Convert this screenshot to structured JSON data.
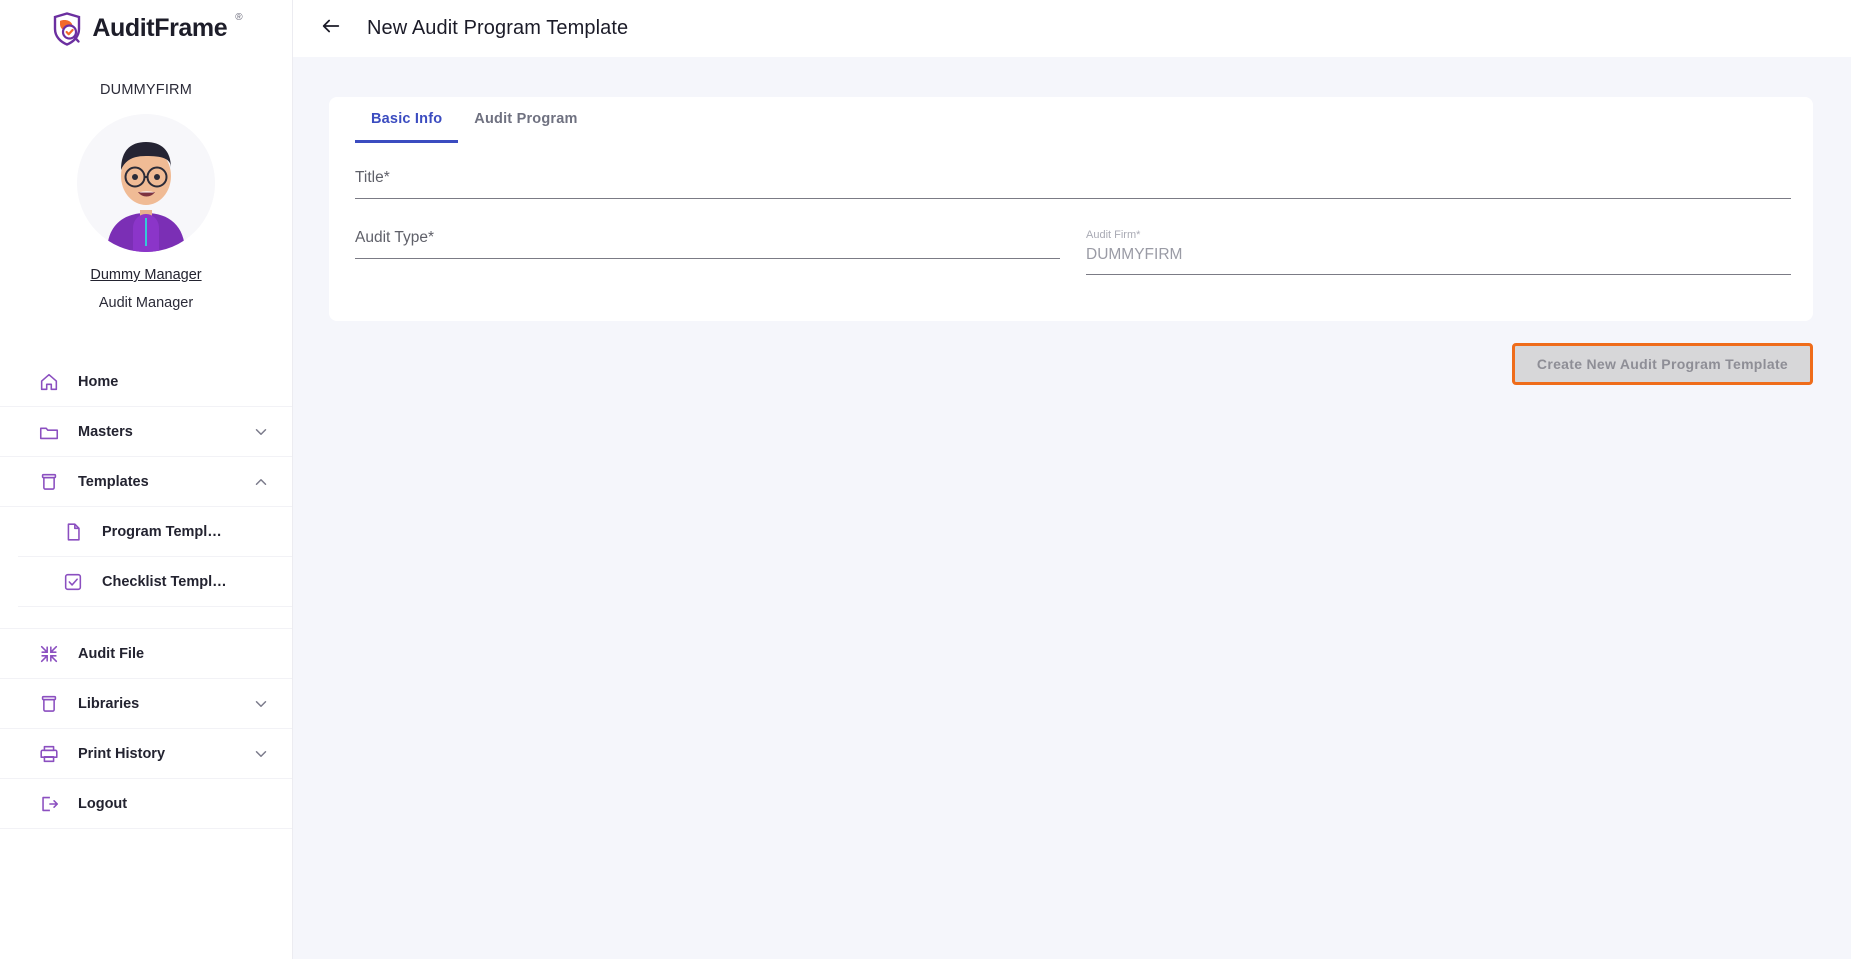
{
  "brand": {
    "name": "AuditFrame",
    "trademark": "®",
    "accent_purple": "#6b2fa0",
    "accent_orange": "#f2692a"
  },
  "sidebar": {
    "firm": "DUMMYFIRM",
    "user_name": "Dummy Manager",
    "user_role": "Audit Manager",
    "items": [
      {
        "label": "Home",
        "icon": "home-icon",
        "chevron": ""
      },
      {
        "label": "Masters",
        "icon": "folder-icon",
        "chevron": "chevron-down-icon"
      },
      {
        "label": "Templates",
        "icon": "archive-icon",
        "chevron": "chevron-up-icon"
      }
    ],
    "sub_items": [
      {
        "label": "Program Templ…",
        "icon": "document-icon"
      },
      {
        "label": "Checklist Templ…",
        "icon": "checkbox-icon"
      }
    ],
    "items_lower": [
      {
        "label": "Audit File",
        "icon": "collapse-icon",
        "chevron": ""
      },
      {
        "label": "Libraries",
        "icon": "archive-icon",
        "chevron": "chevron-down-icon"
      },
      {
        "label": "Print History",
        "icon": "printer-icon",
        "chevron": "chevron-down-icon"
      },
      {
        "label": "Logout",
        "icon": "logout-icon",
        "chevron": ""
      }
    ]
  },
  "header": {
    "title": "New Audit Program Template",
    "back_icon": "arrow-left-icon"
  },
  "main": {
    "tabs": [
      {
        "label": "Basic Info",
        "active": true
      },
      {
        "label": "Audit Program",
        "active": false
      }
    ],
    "fields": {
      "title": {
        "label": "Title*",
        "value": "",
        "placeholder": "Title*"
      },
      "audit_type": {
        "label": "Audit Type*",
        "value": "",
        "placeholder": "Audit Type*"
      },
      "audit_firm": {
        "label": "Audit Firm*",
        "value": "DUMMYFIRM"
      }
    },
    "submit_label": "Create New Audit Program Template",
    "submit_focus_color": "#ef6c1a"
  }
}
